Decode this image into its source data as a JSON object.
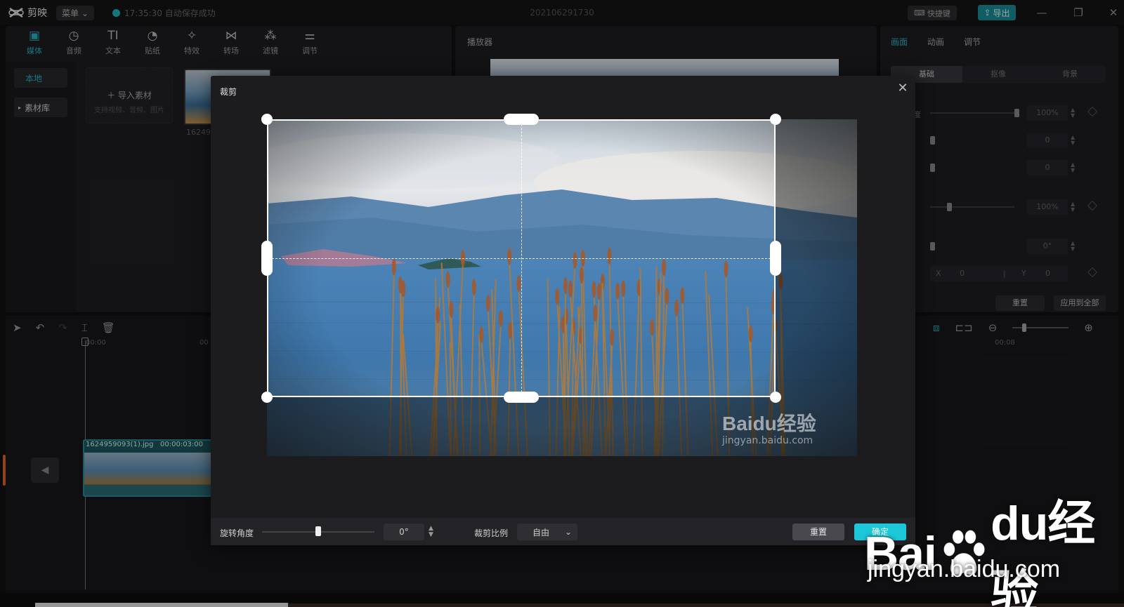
{
  "app": {
    "name": "剪映",
    "menu_label": "菜单",
    "autosave": "17:35:30 自动保存成功",
    "project_title": "202106291730",
    "shortcut_label": "快捷键",
    "export_label": "导出"
  },
  "toolbar": {
    "items": [
      {
        "label": "媒体",
        "icon": "▣"
      },
      {
        "label": "音频",
        "icon": "◷"
      },
      {
        "label": "文本",
        "icon": "TI"
      },
      {
        "label": "贴纸",
        "icon": "◔"
      },
      {
        "label": "特效",
        "icon": "✧"
      },
      {
        "label": "转场",
        "icon": "⋈"
      },
      {
        "label": "滤镜",
        "icon": "⁂"
      },
      {
        "label": "调节",
        "icon": "⚌"
      }
    ]
  },
  "media": {
    "side_local": "本地",
    "side_library": "素材库",
    "import_label": "导入素材",
    "import_hint": "支持视频、音频、图片",
    "thumb_label": "16249"
  },
  "player": {
    "label": "播放器"
  },
  "properties": {
    "tabs": [
      "画面",
      "动画",
      "调节"
    ],
    "subtabs": [
      "基础",
      "抠像",
      "背景"
    ],
    "partial_label": "度",
    "rows": [
      {
        "value": "100%"
      },
      {
        "value": "0"
      },
      {
        "value": "0"
      },
      {
        "value": "100%"
      },
      {
        "value": "0°"
      }
    ],
    "x_label": "X",
    "x_value": "0",
    "y_label": "Y",
    "y_value": "0",
    "reset_label": "重置",
    "apply_all_label": "应用到全部"
  },
  "timeline": {
    "ruler_start": "00:00",
    "ruler_partial": "00",
    "ruler_end": "00:08",
    "clip_name": "1624959093(1).jpg",
    "clip_duration": "00:00:03:00"
  },
  "crop_dialog": {
    "title": "裁剪",
    "rotation_label": "旋转角度",
    "rotation_value": "0°",
    "rotation_level": 0.5,
    "ratio_label": "裁剪比例",
    "ratio_value": "自由",
    "reset_label": "重置",
    "confirm_label": "确定"
  },
  "watermark": {
    "small_brand": "Baidu经验",
    "small_url": "jingyan.baidu.com",
    "big_left": "Bai",
    "big_right": "du经验",
    "big_url": "jingyan.baidu.com"
  },
  "colors": {
    "accent": "#1cc7d7",
    "export": "#1a8f99",
    "clip_border": "#2a8c95"
  }
}
